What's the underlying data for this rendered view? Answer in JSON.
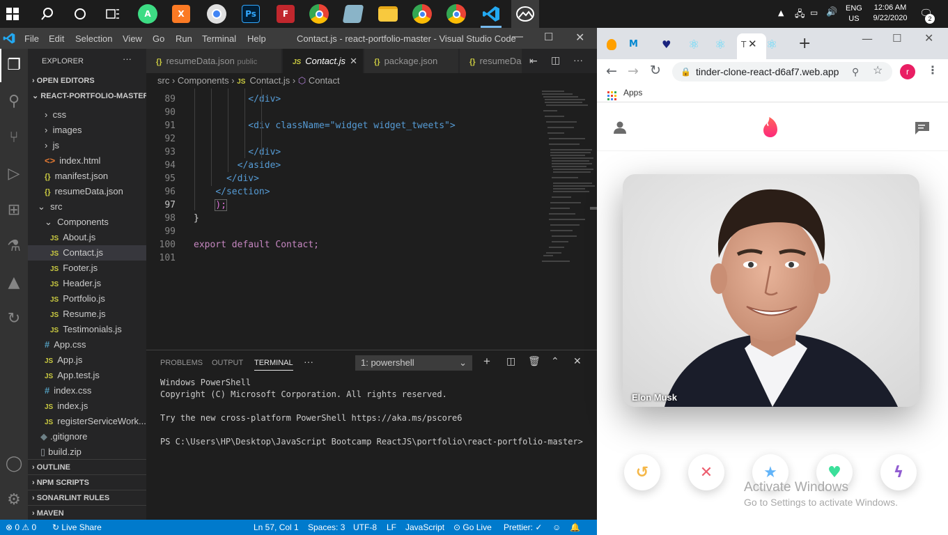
{
  "taskbar": {
    "lang": "ENG",
    "region": "US",
    "time": "12:06 AM",
    "date": "9/22/2020",
    "notification_count": "2"
  },
  "vscode": {
    "menu": [
      "File",
      "Edit",
      "Selection",
      "View",
      "Go",
      "Run",
      "Terminal",
      "Help"
    ],
    "window_title": "Contact.js - react-portfolio-master - Visual Studio Code",
    "explorer_label": "EXPLORER",
    "open_editors": "OPEN EDITORS",
    "project": "REACT-PORTFOLIO-MASTER",
    "tree": [
      "css",
      "images",
      "js",
      "index.html",
      "manifest.json",
      "resumeData.json",
      "src",
      "Components",
      "About.js",
      "Contact.js",
      "Footer.js",
      "Header.js",
      "Portfolio.js",
      "Resume.js",
      "Testimonials.js",
      "App.css",
      "App.js",
      "App.test.js",
      "index.css",
      "index.js",
      "registerServiceWork...",
      ".gitignore",
      "build.zip"
    ],
    "sections": [
      "OUTLINE",
      "NPM SCRIPTS",
      "SONARLINT RULES",
      "MAVEN"
    ],
    "tabs": [
      {
        "name": "resumeData.json",
        "desc": "public"
      },
      {
        "name": "Contact.js",
        "desc": ""
      },
      {
        "name": "package.json",
        "desc": ""
      },
      {
        "name": "resumeDa",
        "desc": ""
      }
    ],
    "breadcrumb": [
      "src",
      "Components",
      "Contact.js",
      "Contact"
    ],
    "code_lines": [
      {
        "n": "89",
        "indent": "          ",
        "text": "</div>"
      },
      {
        "n": "90",
        "indent": "",
        "text": ""
      },
      {
        "n": "91",
        "indent": "          ",
        "text": "<div className=\"widget widget_tweets\">"
      },
      {
        "n": "92",
        "indent": "",
        "text": ""
      },
      {
        "n": "93",
        "indent": "          ",
        "text": "</div>"
      },
      {
        "n": "94",
        "indent": "        ",
        "text": "</aside>"
      },
      {
        "n": "95",
        "indent": "      ",
        "text": "</div>"
      },
      {
        "n": "96",
        "indent": "    ",
        "text": "</section>"
      },
      {
        "n": "97",
        "indent": "    ",
        "text": ");"
      },
      {
        "n": "98",
        "indent": "",
        "text": "}"
      },
      {
        "n": "99",
        "indent": "",
        "text": ""
      },
      {
        "n": "100",
        "indent": "",
        "text": "export default Contact;"
      },
      {
        "n": "101",
        "indent": "",
        "text": ""
      }
    ],
    "panel_tabs": [
      "PROBLEMS",
      "OUTPUT",
      "TERMINAL"
    ],
    "terminal_select": "1: powershell",
    "terminal_lines": [
      "Windows PowerShell",
      "Copyright (C) Microsoft Corporation. All rights reserved.",
      "",
      "Try the new cross-platform PowerShell https://aka.ms/pscore6",
      "",
      "PS C:\\Users\\HP\\Desktop\\JavaScript Bootcamp ReactJS\\portfolio\\react-portfolio-master>"
    ],
    "status": {
      "errors": "0",
      "warnings": "0",
      "live_share": "Live Share",
      "position": "Ln 57, Col 1",
      "spaces": "Spaces: 3",
      "encoding": "UTF-8",
      "eol": "LF",
      "language": "JavaScript",
      "go_live": "Go Live",
      "prettier": "Prettier:"
    }
  },
  "chrome": {
    "url": "tinder-clone-react-d6af7.web.app",
    "apps_label": "Apps",
    "profile_initial": "r",
    "active_tab_label": "T"
  },
  "tinder": {
    "card_name": "Elon Musk",
    "buttons": [
      "undo",
      "dislike",
      "super-like",
      "like",
      "boost"
    ]
  },
  "watermark": {
    "title": "Activate Windows",
    "subtitle": "Go to Settings to activate Windows."
  },
  "colors": {
    "vscode_blue": "#007acc",
    "tinder_red": "#fe3c72"
  }
}
